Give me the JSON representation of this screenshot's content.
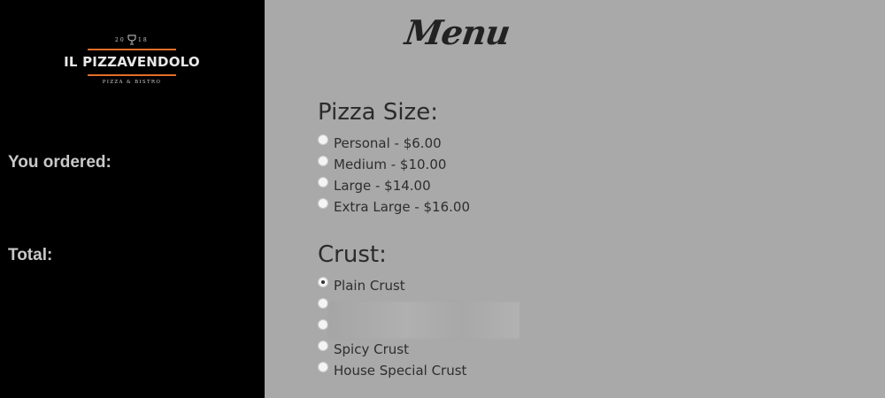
{
  "sidebar": {
    "logo": {
      "year_left": "20",
      "year_right": "18",
      "name": "IL PIZZAVENDOLO",
      "tagline": "PIZZA & BISTRO",
      "accent_color": "#e36d2a",
      "icon": "wine-glass-icon"
    },
    "ordered_label": "You ordered:",
    "total_label": "Total:"
  },
  "main": {
    "title": "Menu",
    "size_section": {
      "title": "Pizza Size:",
      "options": [
        {
          "label": "Personal - $6.00",
          "checked": false
        },
        {
          "label": "Medium - $10.00",
          "checked": false
        },
        {
          "label": "Large - $14.00",
          "checked": false
        },
        {
          "label": "Extra Large - $16.00",
          "checked": false
        }
      ]
    },
    "crust_section": {
      "title": "Crust:",
      "options": [
        {
          "label": "Plain Crust",
          "checked": true
        },
        {
          "label": "",
          "checked": false
        },
        {
          "label": "",
          "checked": false
        },
        {
          "label": "Spicy Crust",
          "checked": false
        },
        {
          "label": "House Special Crust",
          "checked": false
        }
      ]
    }
  }
}
